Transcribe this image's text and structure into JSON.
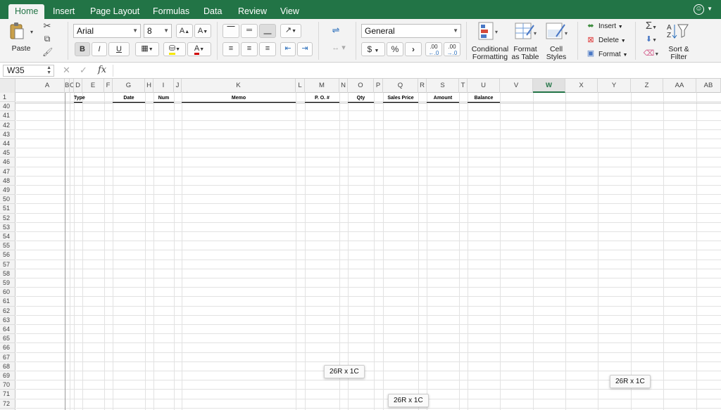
{
  "tabs": [
    "Home",
    "Insert",
    "Page Layout",
    "Formulas",
    "Data",
    "Review",
    "View"
  ],
  "ribbon": {
    "paste_label": "Paste",
    "font_name": "Arial",
    "font_size": "8",
    "number_format": "General",
    "currency_symbol": "$",
    "percent_symbol": "%",
    "comma_symbol": "›",
    "dec_increase": ".00",
    "dec_decrease": ".00",
    "conditional_formatting": [
      "Conditional",
      "Formatting"
    ],
    "format_as_table": [
      "Format",
      "as Table"
    ],
    "cell_styles": [
      "Cell",
      "Styles"
    ],
    "insert_label": "Insert",
    "delete_label": "Delete",
    "format_label": "Format",
    "sort_filter": [
      "Sort &",
      "Filter"
    ],
    "bold": "B",
    "italic": "I",
    "underline": "U"
  },
  "formula_bar": {
    "name_box": "W35",
    "fx": "fx",
    "cancel": "✕",
    "confirm": "✓",
    "value": ""
  },
  "columns": [
    "A",
    "B",
    "C",
    "D",
    "E",
    "F",
    "G",
    "H",
    "I",
    "J",
    "K",
    "L",
    "M",
    "N",
    "O",
    "P",
    "Q",
    "R",
    "S",
    "T",
    "U",
    "V",
    "W",
    "X",
    "Y",
    "Z",
    "AA",
    "AB"
  ],
  "selected_column": "W",
  "rows": [
    "1",
    "40",
    "41",
    "42",
    "43",
    "44",
    "45",
    "46",
    "47",
    "48",
    "49",
    "50",
    "51",
    "52",
    "53",
    "54",
    "55",
    "56",
    "57",
    "58",
    "59",
    "60",
    "61",
    "62",
    "63",
    "64",
    "65",
    "66",
    "67",
    "68",
    "69",
    "70",
    "71",
    "72"
  ],
  "header_row": {
    "type": "Type",
    "date": "Date",
    "num": "Num",
    "memo": "Memo",
    "po": "P. O. #",
    "qty": "Qty",
    "sales_price": "Sales Price",
    "amount": "Amount",
    "balance": "Balance"
  },
  "selection_tooltips": [
    "26R x 1C",
    "26R x 1C",
    "26R x 1C"
  ],
  "colors": {
    "accent": "#227446",
    "ribbon": "#f3f3f3"
  }
}
